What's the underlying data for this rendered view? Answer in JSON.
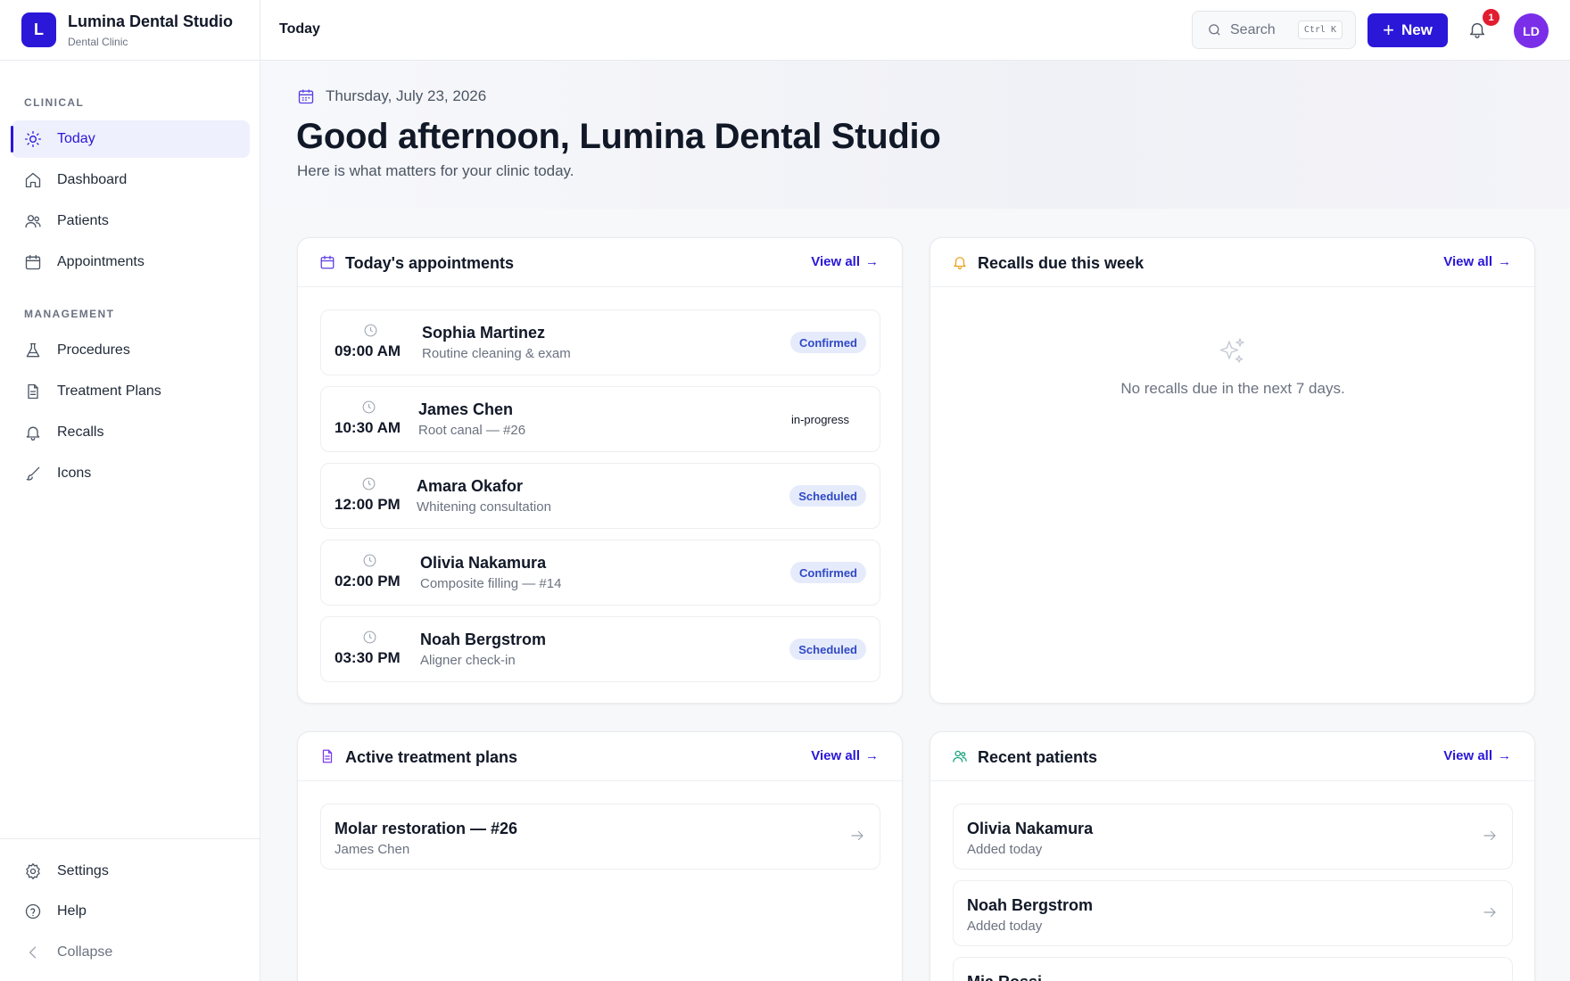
{
  "brand": {
    "initial": "L",
    "name": "Lumina Dental Studio",
    "subtitle": "Dental Clinic"
  },
  "sidebar": {
    "clinical_label": "CLINICAL",
    "management_label": "MANAGEMENT",
    "clinical": [
      {
        "label": "Today",
        "icon": "sun-icon",
        "active": true
      },
      {
        "label": "Dashboard",
        "icon": "home-icon"
      },
      {
        "label": "Patients",
        "icon": "users-icon"
      },
      {
        "label": "Appointments",
        "icon": "calendar-icon"
      }
    ],
    "management": [
      {
        "label": "Procedures",
        "icon": "flask-icon"
      },
      {
        "label": "Treatment Plans",
        "icon": "document-icon"
      },
      {
        "label": "Recalls",
        "icon": "bell-icon"
      },
      {
        "label": "Icons",
        "icon": "brush-icon"
      }
    ],
    "bottom": [
      {
        "label": "Settings",
        "icon": "gear-icon"
      },
      {
        "label": "Help",
        "icon": "help-icon"
      },
      {
        "label": "Collapse",
        "icon": "chevron-left-icon"
      }
    ]
  },
  "topbar": {
    "breadcrumb": "Today",
    "search_placeholder": "Search",
    "search_shortcut": "Ctrl K",
    "new_label": "New",
    "notification_count": "1",
    "avatar_initials": "LD"
  },
  "hero": {
    "date": "Thursday, July 23, 2026",
    "greeting": "Good afternoon, Lumina Dental Studio",
    "subtitle": "Here is what matters for your clinic today."
  },
  "appointments": {
    "title": "Today's appointments",
    "view_all": "View all",
    "items": [
      {
        "time": "09:00 AM",
        "name": "Sophia Martinez",
        "desc": "Routine cleaning & exam",
        "status": "Confirmed",
        "badge": true
      },
      {
        "time": "10:30 AM",
        "name": "James Chen",
        "desc": "Root canal — #26",
        "status": "in-progress",
        "badge": false
      },
      {
        "time": "12:00 PM",
        "name": "Amara Okafor",
        "desc": "Whitening consultation",
        "status": "Scheduled",
        "badge": true
      },
      {
        "time": "02:00 PM",
        "name": "Olivia Nakamura",
        "desc": "Composite filling — #14",
        "status": "Confirmed",
        "badge": true
      },
      {
        "time": "03:30 PM",
        "name": "Noah Bergstrom",
        "desc": "Aligner check-in",
        "status": "Scheduled",
        "badge": true
      }
    ]
  },
  "recalls": {
    "title": "Recalls due this week",
    "view_all": "View all",
    "empty": "No recalls due in the next 7 days."
  },
  "treatment_plans": {
    "title": "Active treatment plans",
    "view_all": "View all",
    "items": [
      {
        "title": "Molar restoration — #26",
        "patient": "James Chen"
      }
    ]
  },
  "recent_patients": {
    "title": "Recent patients",
    "view_all": "View all",
    "items": [
      {
        "name": "Olivia Nakamura",
        "meta": "Added today"
      },
      {
        "name": "Noah Bergstrom",
        "meta": "Added today"
      },
      {
        "name": "Mia Rossi",
        "meta": ""
      }
    ]
  },
  "colors": {
    "accent": "#2a17d8",
    "badge_bg": "#e6ebfb",
    "badge_text": "#3049c4",
    "notification": "#e11d2f",
    "avatar": "#7a2ee8"
  }
}
